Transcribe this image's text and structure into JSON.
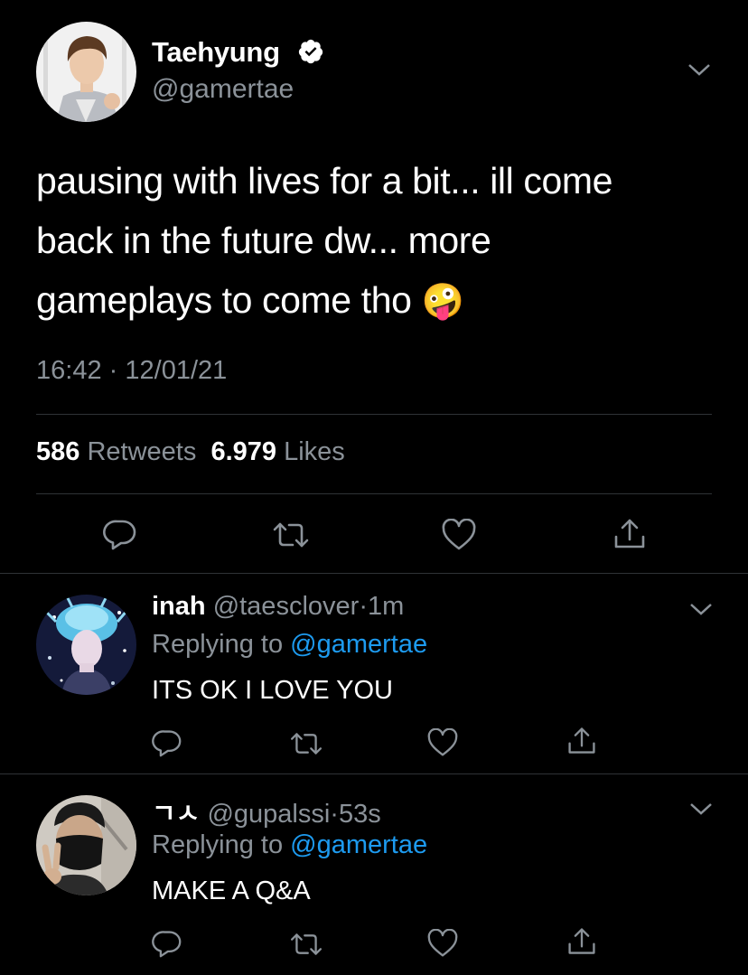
{
  "main_tweet": {
    "name": "Taehyung",
    "handle": "@gamertae",
    "text_line1": "pausing with lives for a bit... ill come",
    "text_line2": "back in the future dw... more",
    "text_line3": "gameplays to come tho",
    "emoji": "🤪",
    "time": "16:42",
    "separator": "·",
    "date": "12/01/21",
    "retweets_count": "586",
    "retweets_label": "Retweets",
    "likes_count": "6.979",
    "likes_label": "Likes"
  },
  "replies": [
    {
      "name": "inah",
      "handle": "@taesclover",
      "separator": "·",
      "time": "1m",
      "replying_prefix": "Replying to",
      "replying_handle": "@gamertae",
      "text": "ITS OK I LOVE YOU"
    },
    {
      "name": "ㄱㅅ",
      "handle": "@gupalssi",
      "separator": "·",
      "time": "53s",
      "replying_prefix": "Replying to",
      "replying_handle": "@gamertae",
      "text": "MAKE A Q&A"
    }
  ],
  "colors": {
    "background": "#000000",
    "secondary_text": "#8b9299",
    "link_blue": "#1d9bf0",
    "divider": "#2f3336"
  },
  "icons": [
    "chevron-down-icon",
    "verified-badge-icon",
    "reply-icon",
    "retweet-icon",
    "like-icon",
    "share-icon"
  ]
}
